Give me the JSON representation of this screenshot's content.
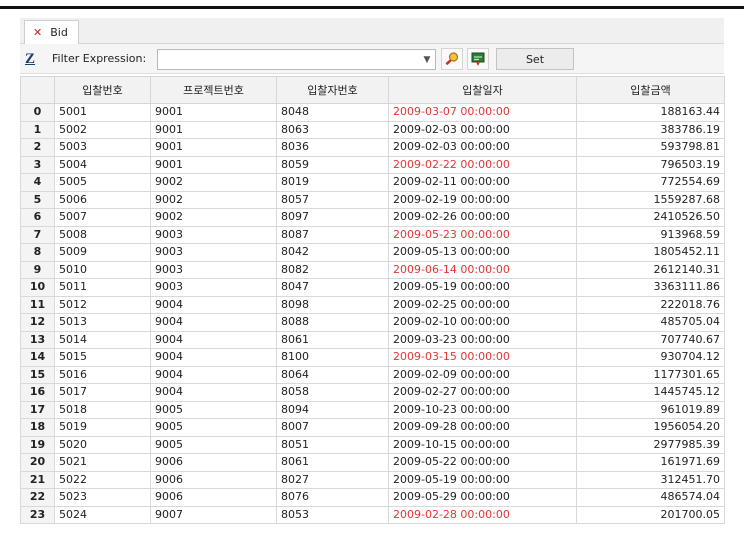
{
  "tab": {
    "label": "Bid"
  },
  "filter": {
    "label": "Filter Expression:",
    "value": "",
    "set_label": "Set"
  },
  "columns": [
    "",
    "입찰번호",
    "프로젝트번호",
    "입찰자번호",
    "입찰일자",
    "입찰금액"
  ],
  "colors": {
    "highlight_date": "#e33535"
  },
  "rows": [
    {
      "idx": "0",
      "bid": "5001",
      "project": "9001",
      "bidder": "8048",
      "date": "2009-03-07 00:00:00",
      "amount": "188163.44",
      "highlight": true
    },
    {
      "idx": "1",
      "bid": "5002",
      "project": "9001",
      "bidder": "8063",
      "date": "2009-02-03 00:00:00",
      "amount": "383786.19",
      "highlight": false
    },
    {
      "idx": "2",
      "bid": "5003",
      "project": "9001",
      "bidder": "8036",
      "date": "2009-02-03 00:00:00",
      "amount": "593798.81",
      "highlight": false
    },
    {
      "idx": "3",
      "bid": "5004",
      "project": "9001",
      "bidder": "8059",
      "date": "2009-02-22 00:00:00",
      "amount": "796503.19",
      "highlight": true
    },
    {
      "idx": "4",
      "bid": "5005",
      "project": "9002",
      "bidder": "8019",
      "date": "2009-02-11 00:00:00",
      "amount": "772554.69",
      "highlight": false
    },
    {
      "idx": "5",
      "bid": "5006",
      "project": "9002",
      "bidder": "8057",
      "date": "2009-02-19 00:00:00",
      "amount": "1559287.68",
      "highlight": false
    },
    {
      "idx": "6",
      "bid": "5007",
      "project": "9002",
      "bidder": "8097",
      "date": "2009-02-26 00:00:00",
      "amount": "2410526.50",
      "highlight": false
    },
    {
      "idx": "7",
      "bid": "5008",
      "project": "9003",
      "bidder": "8087",
      "date": "2009-05-23 00:00:00",
      "amount": "913968.59",
      "highlight": true
    },
    {
      "idx": "8",
      "bid": "5009",
      "project": "9003",
      "bidder": "8042",
      "date": "2009-05-13 00:00:00",
      "amount": "1805452.11",
      "highlight": false
    },
    {
      "idx": "9",
      "bid": "5010",
      "project": "9003",
      "bidder": "8082",
      "date": "2009-06-14 00:00:00",
      "amount": "2612140.31",
      "highlight": true
    },
    {
      "idx": "10",
      "bid": "5011",
      "project": "9003",
      "bidder": "8047",
      "date": "2009-05-19 00:00:00",
      "amount": "3363111.86",
      "highlight": false
    },
    {
      "idx": "11",
      "bid": "5012",
      "project": "9004",
      "bidder": "8098",
      "date": "2009-02-25 00:00:00",
      "amount": "222018.76",
      "highlight": false
    },
    {
      "idx": "12",
      "bid": "5013",
      "project": "9004",
      "bidder": "8088",
      "date": "2009-02-10 00:00:00",
      "amount": "485705.04",
      "highlight": false
    },
    {
      "idx": "13",
      "bid": "5014",
      "project": "9004",
      "bidder": "8061",
      "date": "2009-03-23 00:00:00",
      "amount": "707740.67",
      "highlight": false
    },
    {
      "idx": "14",
      "bid": "5015",
      "project": "9004",
      "bidder": "8100",
      "date": "2009-03-15 00:00:00",
      "amount": "930704.12",
      "highlight": true
    },
    {
      "idx": "15",
      "bid": "5016",
      "project": "9004",
      "bidder": "8064",
      "date": "2009-02-09 00:00:00",
      "amount": "1177301.65",
      "highlight": false
    },
    {
      "idx": "16",
      "bid": "5017",
      "project": "9004",
      "bidder": "8058",
      "date": "2009-02-27 00:00:00",
      "amount": "1445745.12",
      "highlight": false
    },
    {
      "idx": "17",
      "bid": "5018",
      "project": "9005",
      "bidder": "8094",
      "date": "2009-10-23 00:00:00",
      "amount": "961019.89",
      "highlight": false
    },
    {
      "idx": "18",
      "bid": "5019",
      "project": "9005",
      "bidder": "8007",
      "date": "2009-09-28 00:00:00",
      "amount": "1956054.20",
      "highlight": false
    },
    {
      "idx": "19",
      "bid": "5020",
      "project": "9005",
      "bidder": "8051",
      "date": "2009-10-15 00:00:00",
      "amount": "2977985.39",
      "highlight": false
    },
    {
      "idx": "20",
      "bid": "5021",
      "project": "9006",
      "bidder": "8061",
      "date": "2009-05-22 00:00:00",
      "amount": "161971.69",
      "highlight": false
    },
    {
      "idx": "21",
      "bid": "5022",
      "project": "9006",
      "bidder": "8027",
      "date": "2009-05-19 00:00:00",
      "amount": "312451.70",
      "highlight": false
    },
    {
      "idx": "22",
      "bid": "5023",
      "project": "9006",
      "bidder": "8076",
      "date": "2009-05-29 00:00:00",
      "amount": "486574.04",
      "highlight": false
    },
    {
      "idx": "23",
      "bid": "5024",
      "project": "9007",
      "bidder": "8053",
      "date": "2009-02-28 00:00:00",
      "amount": "201700.05",
      "highlight": true
    }
  ]
}
